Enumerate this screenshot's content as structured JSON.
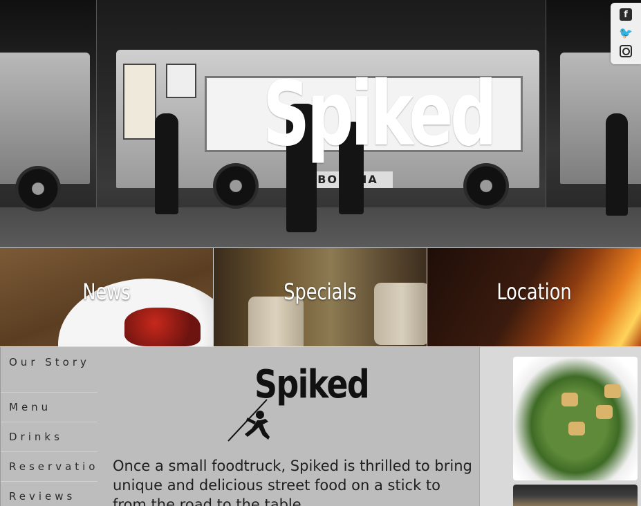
{
  "hero": {
    "title": "Spiked",
    "truck_brand": "BOBCHA"
  },
  "social": {
    "facebook_glyph": "f",
    "twitter_glyph": "🐦"
  },
  "tiles": [
    {
      "label": "News"
    },
    {
      "label": "Specials"
    },
    {
      "label": "Location"
    }
  ],
  "nav": {
    "items": [
      {
        "label": "Our Story"
      },
      {
        "label": "Menu"
      },
      {
        "label": "Drinks"
      },
      {
        "label": "Reservations"
      },
      {
        "label": "Reviews"
      }
    ]
  },
  "logo": {
    "word": "Spiked"
  },
  "intro": {
    "text": "Once a small foodtruck, Spiked is thrilled to bring unique and delicious street food on a stick to from the road to the table."
  }
}
